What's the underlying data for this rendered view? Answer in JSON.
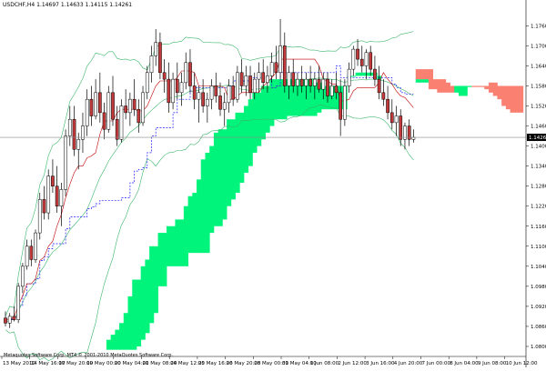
{
  "header": {
    "symbol": "USDCHF,H4",
    "quote": "1.14697 1.14633 1.14115 1.14261"
  },
  "copyright": "Metaquotes Software Corp. MT4 © 2001-2010 MetaQuotes Software Corp.",
  "current_price_label": "1.14261",
  "colors": {
    "background": "#ffffff",
    "cloud_bull": "#00f47b",
    "cloud_bear": "#fa8072",
    "candle_up": "#ffffff",
    "candle_down": "#c0393b",
    "bollinger": "#3bb56b",
    "kijun": "#1a1aff",
    "tenkan": "#c00000",
    "price_line": "#8a8a8a"
  },
  "chart_data": {
    "type": "candlestick",
    "y_ticks": [
      "1.17600",
      "1.17000",
      "1.16400",
      "1.15800",
      "1.15200",
      "1.14600",
      "1.14000",
      "1.13400",
      "1.12800",
      "1.12200",
      "1.11600",
      "1.11000",
      "1.10400",
      "1.09800",
      "1.09200",
      "1.08600",
      "1.08000"
    ],
    "x_ticks": [
      "13 May 2010",
      "14 May 16:00",
      "17 May 20:00",
      "19 May 00:00",
      "20 May 04:00",
      "21 May 08:00",
      "24 May 12:00",
      "25 May 16:00",
      "26 May 20:00",
      "28 May 00:00",
      "31 May 04:00",
      "1 Jun 08:00",
      "2 Jun 12:00",
      "3 Jun 16:00",
      "4 Jun 20:00",
      "7 Jun 00:00",
      "8 Jun 04:00",
      "9 Jun 08:00",
      "10 Jun 12:00"
    ],
    "ylim": [
      1.077,
      1.181
    ],
    "candles": [
      [
        1.0885,
        1.0905,
        1.086,
        1.087
      ],
      [
        1.087,
        1.09,
        1.0855,
        1.089
      ],
      [
        1.089,
        1.092,
        1.0875,
        1.088
      ],
      [
        1.088,
        1.099,
        1.087,
        1.098
      ],
      [
        1.098,
        1.105,
        1.096,
        1.104
      ],
      [
        1.104,
        1.112,
        1.103,
        1.11
      ],
      [
        1.11,
        1.112,
        1.104,
        1.106
      ],
      [
        1.106,
        1.115,
        1.105,
        1.114
      ],
      [
        1.114,
        1.126,
        1.112,
        1.124
      ],
      [
        1.124,
        1.128,
        1.118,
        1.12
      ],
      [
        1.12,
        1.133,
        1.118,
        1.131
      ],
      [
        1.131,
        1.136,
        1.126,
        1.128
      ],
      [
        1.128,
        1.134,
        1.12,
        1.122
      ],
      [
        1.122,
        1.129,
        1.116,
        1.127
      ],
      [
        1.127,
        1.145,
        1.125,
        1.143
      ],
      [
        1.143,
        1.152,
        1.14,
        1.148
      ],
      [
        1.148,
        1.152,
        1.137,
        1.139
      ],
      [
        1.139,
        1.144,
        1.133,
        1.142
      ],
      [
        1.142,
        1.15,
        1.138,
        1.146
      ],
      [
        1.146,
        1.157,
        1.143,
        1.154
      ],
      [
        1.154,
        1.158,
        1.146,
        1.149
      ],
      [
        1.149,
        1.16,
        1.148,
        1.156
      ],
      [
        1.156,
        1.162,
        1.147,
        1.15
      ],
      [
        1.15,
        1.153,
        1.142,
        1.145
      ],
      [
        1.145,
        1.158,
        1.144,
        1.156
      ],
      [
        1.156,
        1.161,
        1.146,
        1.148
      ],
      [
        1.148,
        1.152,
        1.14,
        1.142
      ],
      [
        1.142,
        1.154,
        1.141,
        1.152
      ],
      [
        1.152,
        1.157,
        1.148,
        1.15
      ],
      [
        1.15,
        1.156,
        1.146,
        1.154
      ],
      [
        1.154,
        1.16,
        1.149,
        1.151
      ],
      [
        1.151,
        1.154,
        1.144,
        1.147
      ],
      [
        1.147,
        1.158,
        1.146,
        1.156
      ],
      [
        1.156,
        1.164,
        1.154,
        1.162
      ],
      [
        1.162,
        1.17,
        1.159,
        1.167
      ],
      [
        1.167,
        1.175,
        1.164,
        1.171
      ],
      [
        1.171,
        1.174,
        1.16,
        1.162
      ],
      [
        1.162,
        1.166,
        1.156,
        1.16
      ],
      [
        1.16,
        1.165,
        1.15,
        1.153
      ],
      [
        1.153,
        1.162,
        1.151,
        1.16
      ],
      [
        1.16,
        1.165,
        1.154,
        1.156
      ],
      [
        1.156,
        1.162,
        1.152,
        1.159
      ],
      [
        1.159,
        1.168,
        1.157,
        1.165
      ],
      [
        1.165,
        1.169,
        1.156,
        1.158
      ],
      [
        1.158,
        1.162,
        1.151,
        1.154
      ],
      [
        1.154,
        1.158,
        1.147,
        1.156
      ],
      [
        1.156,
        1.16,
        1.15,
        1.152
      ],
      [
        1.152,
        1.156,
        1.147,
        1.154
      ],
      [
        1.154,
        1.16,
        1.151,
        1.158
      ],
      [
        1.158,
        1.162,
        1.153,
        1.155
      ],
      [
        1.155,
        1.159,
        1.149,
        1.151
      ],
      [
        1.151,
        1.156,
        1.146,
        1.153
      ],
      [
        1.153,
        1.16,
        1.15,
        1.158
      ],
      [
        1.158,
        1.161,
        1.152,
        1.154
      ],
      [
        1.154,
        1.164,
        1.153,
        1.162
      ],
      [
        1.162,
        1.166,
        1.156,
        1.158
      ],
      [
        1.158,
        1.164,
        1.155,
        1.161
      ],
      [
        1.161,
        1.164,
        1.154,
        1.156
      ],
      [
        1.156,
        1.162,
        1.154,
        1.16
      ],
      [
        1.16,
        1.165,
        1.156,
        1.162
      ],
      [
        1.162,
        1.166,
        1.157,
        1.159
      ],
      [
        1.159,
        1.164,
        1.156,
        1.161
      ],
      [
        1.161,
        1.168,
        1.159,
        1.165
      ],
      [
        1.165,
        1.17,
        1.16,
        1.162
      ],
      [
        1.162,
        1.178,
        1.16,
        1.17
      ],
      [
        1.17,
        1.174,
        1.156,
        1.158
      ],
      [
        1.158,
        1.164,
        1.154,
        1.162
      ],
      [
        1.162,
        1.166,
        1.156,
        1.158
      ],
      [
        1.158,
        1.162,
        1.155,
        1.16
      ],
      [
        1.16,
        1.164,
        1.156,
        1.158
      ],
      [
        1.158,
        1.162,
        1.154,
        1.16
      ],
      [
        1.16,
        1.164,
        1.156,
        1.158
      ],
      [
        1.158,
        1.162,
        1.154,
        1.16
      ],
      [
        1.16,
        1.164,
        1.156,
        1.157
      ],
      [
        1.157,
        1.162,
        1.154,
        1.16
      ],
      [
        1.16,
        1.162,
        1.153,
        1.155
      ],
      [
        1.155,
        1.16,
        1.154,
        1.158
      ],
      [
        1.158,
        1.162,
        1.154,
        1.156
      ],
      [
        1.156,
        1.16,
        1.143,
        1.148
      ],
      [
        1.148,
        1.16,
        1.146,
        1.158
      ],
      [
        1.158,
        1.165,
        1.156,
        1.163
      ],
      [
        1.163,
        1.17,
        1.161,
        1.169
      ],
      [
        1.169,
        1.172,
        1.164,
        1.166
      ],
      [
        1.166,
        1.17,
        1.162,
        1.164
      ],
      [
        1.164,
        1.169,
        1.16,
        1.168
      ],
      [
        1.168,
        1.17,
        1.161,
        1.163
      ],
      [
        1.163,
        1.167,
        1.158,
        1.16
      ],
      [
        1.16,
        1.164,
        1.154,
        1.156
      ],
      [
        1.156,
        1.16,
        1.152,
        1.154
      ],
      [
        1.154,
        1.158,
        1.148,
        1.15
      ],
      [
        1.15,
        1.154,
        1.145,
        1.147
      ],
      [
        1.147,
        1.152,
        1.143,
        1.149
      ],
      [
        1.149,
        1.151,
        1.14,
        1.142
      ],
      [
        1.142,
        1.147,
        1.139,
        1.146
      ],
      [
        1.146,
        1.148,
        1.14,
        1.142
      ],
      [
        1.142,
        1.145,
        1.141,
        1.1426
      ]
    ],
    "kumo_top": [
      null,
      null,
      null,
      null,
      null,
      null,
      null,
      null,
      null,
      null,
      null,
      null,
      null,
      null,
      null,
      null,
      null,
      null,
      null,
      null,
      null,
      null,
      null,
      null,
      1.082,
      1.0835,
      1.085,
      1.087,
      1.09,
      1.095,
      1.1,
      1.1,
      1.104,
      1.106,
      1.11,
      1.11,
      1.114,
      1.114,
      1.116,
      1.116,
      1.118,
      1.118,
      1.122,
      1.125,
      1.126,
      1.13,
      1.136,
      1.138,
      1.14,
      1.144,
      1.145,
      1.145,
      1.148,
      1.148,
      1.15,
      1.15,
      1.152,
      1.154,
      1.156,
      1.156,
      1.158,
      1.158,
      1.16,
      1.16,
      1.16,
      1.16,
      1.16,
      1.16,
      1.16,
      1.16,
      1.16,
      1.16,
      1.159,
      1.159,
      1.158,
      1.158,
      1.158,
      1.158,
      1.158,
      1.158,
      1.161,
      1.161,
      1.162,
      1.162,
      1.162,
      1.162,
      1.162,
      1.161,
      null,
      null,
      null,
      null,
      null,
      null,
      null,
      null,
      1.16,
      1.16,
      1.16,
      1.16,
      null,
      null,
      null,
      null,
      null,
      null,
      null,
      null,
      null,
      null,
      null,
      null,
      null,
      null,
      null,
      null
    ],
    "kumo_bottom": [
      null,
      null,
      null,
      null,
      null,
      null,
      null,
      null,
      null,
      null,
      null,
      null,
      null,
      null,
      null,
      null,
      null,
      null,
      null,
      null,
      null,
      null,
      null,
      null,
      1.079,
      1.079,
      1.079,
      1.079,
      1.079,
      1.079,
      1.079,
      1.08,
      1.082,
      1.084,
      1.087,
      1.09,
      1.098,
      1.098,
      1.104,
      1.104,
      1.104,
      1.104,
      1.104,
      1.108,
      1.108,
      1.108,
      1.108,
      1.108,
      1.114,
      1.116,
      1.116,
      1.118,
      1.122,
      1.124,
      1.126,
      1.129,
      1.132,
      1.134,
      1.138,
      1.14,
      1.142,
      1.144,
      1.146,
      1.148,
      1.148,
      1.148,
      1.149,
      1.149,
      1.149,
      1.149,
      1.149,
      1.149,
      1.149,
      1.15,
      1.151,
      1.151,
      1.151,
      1.151,
      1.151,
      1.151,
      1.161,
      1.161,
      1.161,
      1.161,
      1.161,
      1.161,
      1.161,
      1.16,
      null,
      null,
      null,
      null,
      null,
      null,
      null,
      null,
      1.159,
      1.159,
      1.159,
      1.159,
      null,
      null,
      null,
      null,
      null,
      null,
      null,
      null,
      null,
      null,
      null,
      null,
      null,
      null,
      null,
      null
    ],
    "future_cloud": {
      "top": [
        1.163,
        1.163,
        1.163,
        1.163,
        1.16,
        1.16,
        1.16,
        1.159,
        1.158,
        1.158,
        1.158,
        1.158,
        1.158,
        1.158,
        1.158,
        1.158,
        1.158,
        1.159,
        1.159,
        1.158,
        1.158,
        1.158,
        1.158,
        1.158,
        1.158
      ],
      "bottom": [
        1.16,
        1.16,
        1.16,
        1.157,
        1.157,
        1.156,
        1.156,
        1.156,
        1.156,
        1.156,
        1.155,
        1.155,
        1.158,
        1.158,
        1.158,
        1.158,
        1.157,
        1.156,
        1.155,
        1.154,
        1.152,
        1.151,
        1.15,
        1.15,
        1.15
      ],
      "bull_segment": [
        9,
        12
      ]
    }
  }
}
